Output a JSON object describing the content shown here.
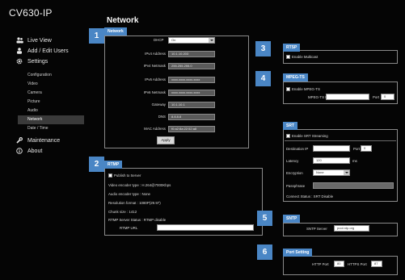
{
  "app": {
    "title": "CV630-IP"
  },
  "page": {
    "title": "Network"
  },
  "sidebar": {
    "main": [
      {
        "label": "Live View",
        "icon": "people-icon"
      },
      {
        "label": "Add / Edit Users",
        "icon": "user-icon"
      },
      {
        "label": "Settings",
        "icon": "gear-icon"
      }
    ],
    "sub": [
      "Configuration",
      "Video",
      "Camera",
      "Picture",
      "Audio",
      "Network",
      "Date / Time"
    ],
    "bottom": [
      {
        "label": "Maintenance",
        "icon": "wrench-icon"
      },
      {
        "label": "About",
        "icon": "info-icon"
      }
    ],
    "active": "Network"
  },
  "badges": [
    "1",
    "2",
    "3",
    "4",
    "5",
    "6"
  ],
  "network": {
    "tag": "Network",
    "dhcp_label": "DHCP",
    "dhcp_value": "On",
    "fields": [
      {
        "label": "IPv4 Address",
        "value": "10.1.10.203"
      },
      {
        "label": "IPv4 Netmask",
        "value": "255.255.255.0"
      },
      {
        "label": "IPv6 Address",
        "value": "xxxx.xxxx.xxxx.xxxx"
      },
      {
        "label": "IPv6 Netmask",
        "value": "xxxx.xxxx.xxxx.xxxx"
      },
      {
        "label": "Gateway",
        "value": "10.1.10.1"
      },
      {
        "label": "DNS",
        "value": "8.8.8.8"
      },
      {
        "label": "MAC Address",
        "value": "f0:a2:8a:22:52:a8"
      }
    ],
    "apply_label": "Apply"
  },
  "rtmp": {
    "tag": "RTMP",
    "publish_label": "Publish to Server",
    "lines": [
      "Video encoder type : H.264@7000Kbps",
      "Audio encoder type : None",
      "Resolution format : 1080P(29.97)",
      "Chunk size : 1412",
      "RTMP Server Status : RTMP disable"
    ],
    "url_label": "RTMP URL"
  },
  "rtsp": {
    "tag": "RTSP",
    "multicast_label": "Enable Multicast"
  },
  "mpeg": {
    "tag": "MPEG-TS",
    "enable_label": "Enable MPEG-TS",
    "ip_label": "MPEG-TS IP",
    "port_label": "Port",
    "port_value": "0"
  },
  "srt": {
    "tag": "SRT",
    "enable_label": "Enable SRT Streaming",
    "dest_label": "Destination IP",
    "port_label": "Port",
    "port_value": "0",
    "latency_label": "Latency",
    "latency_value": "120",
    "latency_unit": "ms",
    "encryption_label": "Encryption",
    "encryption_value": "None",
    "passphrase_label": "Passphrase",
    "status": "Connect Status : SRT Disable"
  },
  "sntp": {
    "tag": "SNTP",
    "server_label": "SNTP Server",
    "server_value": "pool.ntp.org"
  },
  "port": {
    "tag": "Port Setting",
    "http_label": "HTTP Port",
    "http_value": "80",
    "https_label": "HTTPS Port",
    "https_value": "87"
  },
  "colors": {
    "accent": "#4a86c5",
    "background": "#050505",
    "border": "#8a8a8a"
  }
}
